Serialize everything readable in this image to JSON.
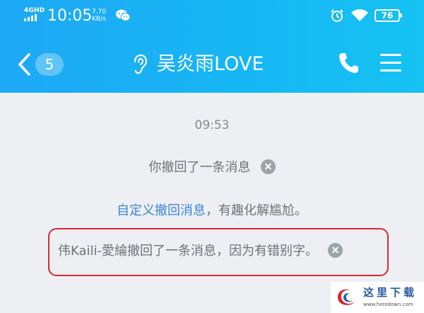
{
  "status_bar": {
    "network": "4GHD",
    "time": "10:05",
    "speed_value": "7.70",
    "speed_unit": "KB/s",
    "battery": "76",
    "icons": [
      "signal-icon",
      "wechat-icon",
      "alarm-icon",
      "wifi-icon",
      "battery-icon"
    ]
  },
  "header": {
    "back_icon": "chevron-left-icon",
    "unread_count": "5",
    "title_icon": "ear-icon",
    "title": "吴炎雨LOVE",
    "call_icon": "phone-icon",
    "menu_icon": "menu-icon",
    "gradient_start": "#1ea8f5",
    "gradient_end": "#15c2f2"
  },
  "chat": {
    "timestamp": "09:53",
    "sys_message_1": "你撤回了一条消息",
    "tip_link": "自定义撤回消息",
    "tip_rest": "，有趣化解尴尬。",
    "sys_message_2": "伟Kaili-愛綸撤回了一条消息，因为有错别字。",
    "link_color": "#3b86d7",
    "highlight_color": "#d42a36"
  },
  "watermark": {
    "text": "这里下载",
    "url": "www.heredown.com"
  }
}
